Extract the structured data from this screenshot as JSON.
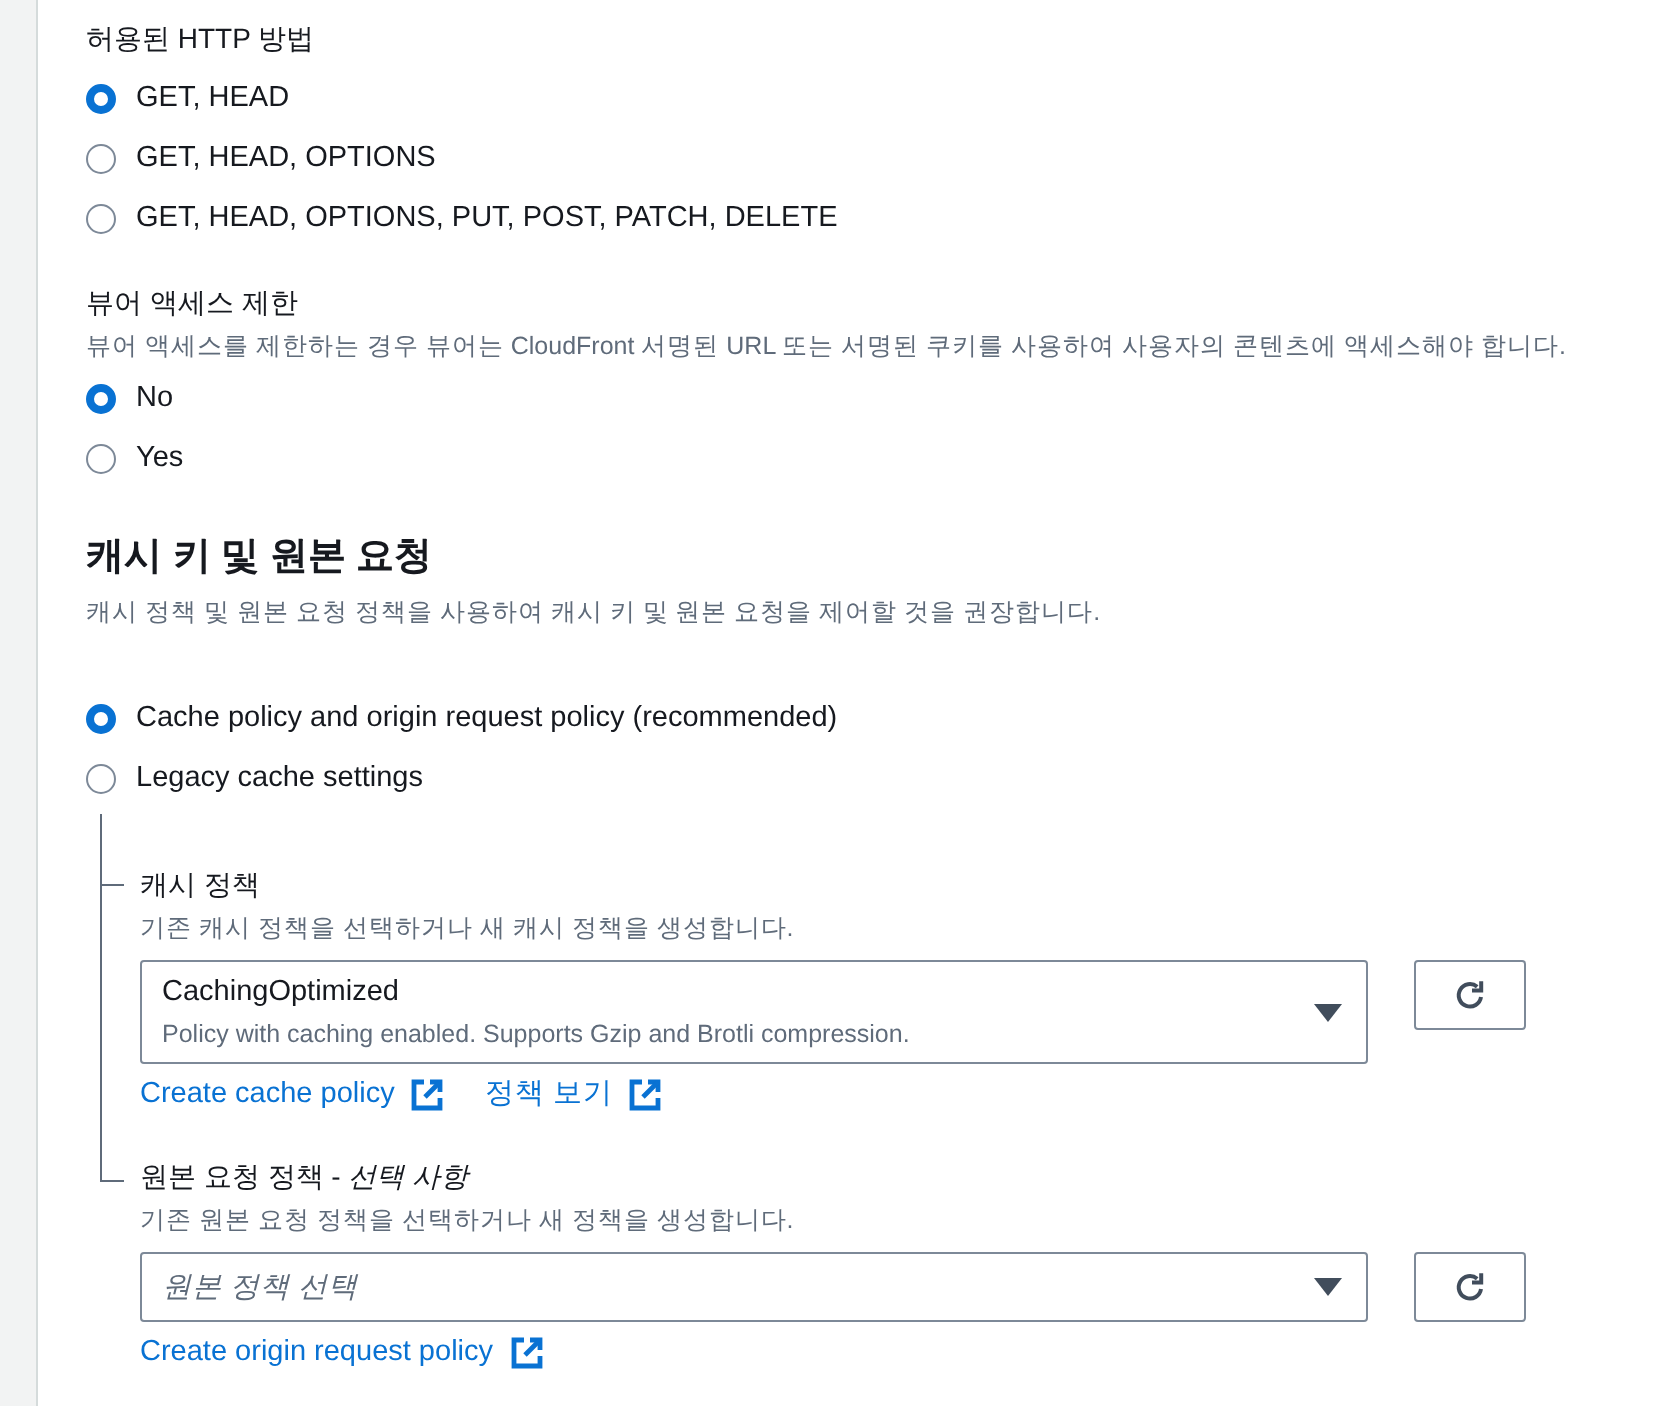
{
  "allowed_methods": {
    "label": "허용된 HTTP 방법",
    "options": [
      {
        "label": "GET, HEAD",
        "selected": true
      },
      {
        "label": "GET, HEAD, OPTIONS",
        "selected": false
      },
      {
        "label": "GET, HEAD, OPTIONS, PUT, POST, PATCH, DELETE",
        "selected": false
      }
    ]
  },
  "viewer_access": {
    "label": "뷰어 액세스 제한",
    "description": "뷰어 액세스를 제한하는 경우 뷰어는 CloudFront 서명된 URL 또는 서명된 쿠키를 사용하여 사용자의 콘텐츠에 액세스해야 합니다.",
    "options": [
      {
        "label": "No",
        "selected": true
      },
      {
        "label": "Yes",
        "selected": false
      }
    ]
  },
  "cache_key": {
    "title": "캐시 키 및 원본 요청",
    "description": "캐시 정책 및 원본 요청 정책을 사용하여 캐시 키 및 원본 요청을 제어할 것을 권장합니다.",
    "options": [
      {
        "label": "Cache policy and origin request policy (recommended)",
        "selected": true
      },
      {
        "label": "Legacy cache settings",
        "selected": false
      }
    ],
    "policies": [
      {
        "label": "캐시 정책",
        "description": "기존 캐시 정책을 선택하거나 새 캐시 정책을 생성합니다.",
        "select": {
          "value": "CachingOptimized",
          "description": "Policy with caching enabled. Supports Gzip and Brotli compression."
        },
        "links": [
          "Create cache policy",
          "정책 보기"
        ]
      },
      {
        "label": "원본 요청 정책 - *선택 사항*",
        "description": "기존 원본 요청 정책을 선택하거나 새 정책을 생성합니다.",
        "select": {
          "placeholder": "원본 정책 선택"
        },
        "links": [
          "Create origin request policy"
        ]
      }
    ]
  }
}
